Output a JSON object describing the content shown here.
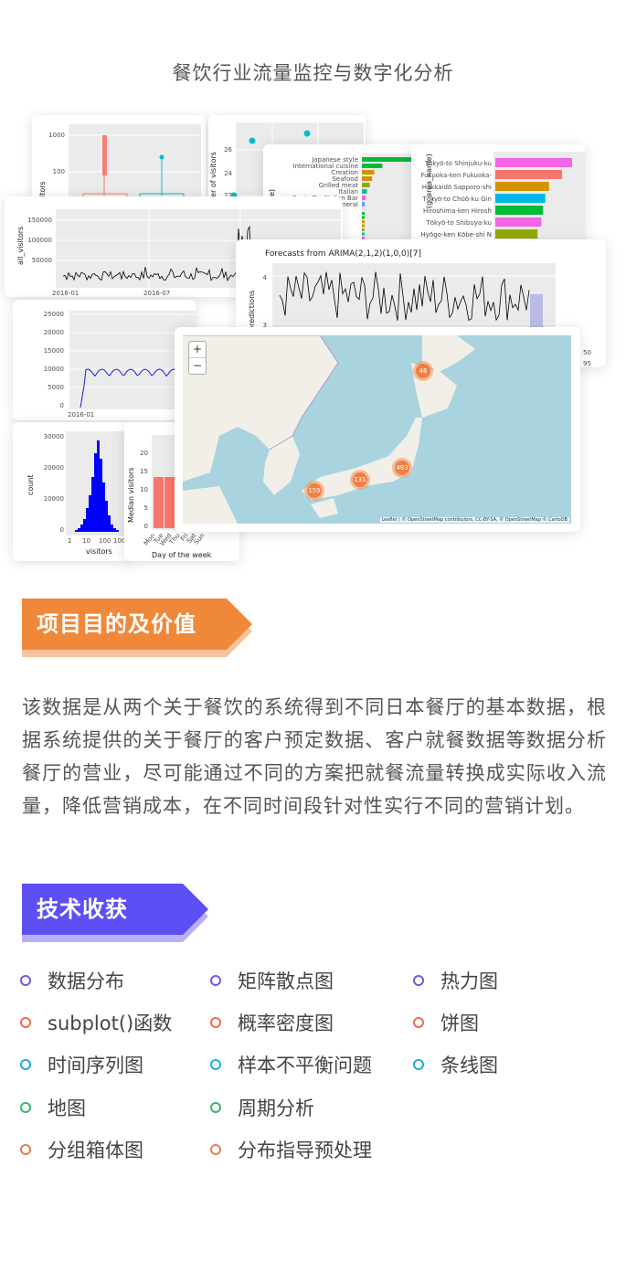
{
  "page": {
    "title": "餐饮行业流量监控与数字化分析"
  },
  "colors": {
    "orange": "#f0883a",
    "purple": "#5e4ff5",
    "dot_purple": "#6a5fe0",
    "dot_red": "#f06a52",
    "dot_blue": "#1ea9e1",
    "dot_green": "#3bb56d",
    "dot_orange": "#ef7a4e"
  },
  "section1": {
    "heading": "项目目的及价值",
    "body": "该数据是从两个关于餐饮的系统得到不同日本餐厅的基本数据，根据系统提供的关于餐厅的客户预定数据、客户就餐数据等数据分析餐厅的营业，尽可能通过不同的方案把就餐流量转换成实际收入流量，降低营销成本，在不同时间段针对性实行不同的营销计划。"
  },
  "section2": {
    "heading": "技术收获",
    "skills": [
      {
        "label": "数据分布",
        "color": "dot_purple"
      },
      {
        "label": "矩阵散点图",
        "color": "dot_purple"
      },
      {
        "label": "热力图",
        "color": "dot_purple"
      },
      {
        "label": "subplot()函数",
        "color": "dot_red"
      },
      {
        "label": "概率密度图",
        "color": "dot_red"
      },
      {
        "label": "饼图",
        "color": "dot_red"
      },
      {
        "label": "时间序列图",
        "color": "dot_blue"
      },
      {
        "label": "样本不平衡问题",
        "color": "dot_blue"
      },
      {
        "label": "条线图",
        "color": "dot_blue"
      },
      {
        "label": "地图",
        "color": "dot_green"
      },
      {
        "label": "周期分析",
        "color": "dot_green"
      },
      {
        "label": "分组箱体图",
        "color": "dot_orange"
      },
      {
        "label": "分布指导预处理",
        "color": "dot_orange"
      }
    ]
  },
  "collage": {
    "boxplot": {
      "y_ticks": [
        "1000",
        "100"
      ],
      "y_label": "itors"
    },
    "scatter": {
      "y_ticks": [
        "26",
        "24",
        "22"
      ],
      "y_label": "ber of visitors"
    },
    "genre_bar": {
      "y_label": "re)",
      "categories": [
        "Japanese style",
        "International cuisine",
        "Creation",
        "Seafood",
        "Grilled meat",
        "Italian",
        "Spain Bar/Italian Bar",
        "Chinese general"
      ],
      "values": [
        1,
        0.36,
        0.22,
        0.18,
        0.14,
        0.09,
        0.07,
        0.05
      ]
    },
    "area_bar": {
      "y_label": "(g_area_name)",
      "categories": [
        "Tōkyō-to Shinjuku-ku",
        "Fukuoka-ken Fukuoka-",
        "Hokkaidō Sapporo-shi",
        "Tōkyō-to Chūō-ku Gin",
        "Hiroshima-ken Hirosh",
        "Tōkyō-to Shibuya-ku",
        "Hyōgo-ken Kōbe-shi N"
      ],
      "values": [
        1,
        0.87,
        0.7,
        0.65,
        0.62,
        0.6,
        0.55
      ],
      "colors": [
        "#f564e3",
        "#f8766d",
        "#d39200",
        "#00b9e3",
        "#00ba38",
        "#f564e3",
        "#93aa00"
      ]
    },
    "all_visitors": {
      "y_label": "all_visitors",
      "y_ticks": [
        "150000",
        "100000",
        "50000"
      ],
      "x_ticks": [
        "2016-01",
        "2016-07"
      ]
    },
    "arima": {
      "title": "Forecasts from ARIMA(2,1,2)(1,0,0)[7]",
      "y_label": "predictions",
      "y_ticks": [
        "4",
        "3"
      ],
      "legend": [
        "50",
        "95"
      ]
    },
    "visitors_line": {
      "y_ticks": [
        "25000",
        "20000",
        "15000",
        "10000",
        "5000",
        "0"
      ],
      "x_ticks": [
        "2016-01"
      ]
    },
    "histogram": {
      "y_label": "count",
      "x_label": "visitors",
      "y_ticks": [
        "30000",
        "20000",
        "10000",
        "0"
      ],
      "x_ticks": [
        "1",
        "10",
        "100",
        "1000"
      ]
    },
    "weekday": {
      "y_label": "Median visitors",
      "x_label": "Day of the week",
      "y_ticks": [
        "20",
        "15",
        "10",
        "5",
        "0"
      ],
      "x_ticks": [
        "Mon",
        "Tue",
        "Wed",
        "Thu",
        "Fri",
        "Sat",
        "Sun"
      ]
    },
    "map": {
      "zoom_in": "+",
      "zoom_out": "−",
      "clusters": [
        "46",
        "493",
        "131",
        "159"
      ],
      "attribution": "Leaflet | © OpenStreetMap contributors, CC-BY-SA, © OpenStreetMap © CartoDB"
    }
  }
}
